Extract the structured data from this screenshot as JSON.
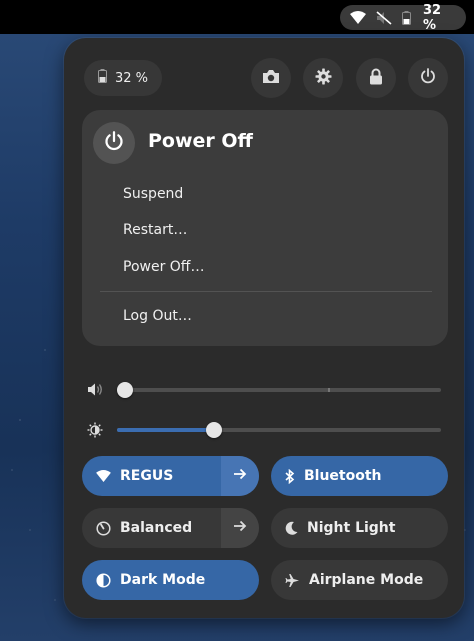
{
  "topbar": {
    "battery_percent": "32 %"
  },
  "quick_settings": {
    "battery_percent": "32 %",
    "power_menu": {
      "title": "Power Off",
      "items": [
        "Suspend",
        "Restart…",
        "Power Off…",
        "Log Out…"
      ]
    },
    "sliders": {
      "volume_level": 0.0,
      "brightness_level": 0.3
    },
    "toggles": [
      {
        "label": "REGUS",
        "icon": "wifi-icon",
        "state": "on",
        "has_arrow": true
      },
      {
        "label": "Bluetooth",
        "icon": "bluetooth-icon",
        "state": "on",
        "has_arrow": false
      },
      {
        "label": "Balanced",
        "icon": "power-profile-icon",
        "state": "off",
        "has_arrow": true
      },
      {
        "label": "Night Light",
        "icon": "moon-icon",
        "state": "off",
        "has_arrow": false
      },
      {
        "label": "Dark Mode",
        "icon": "dark-mode-icon",
        "state": "on",
        "has_arrow": false
      },
      {
        "label": "Airplane Mode",
        "icon": "airplane-icon",
        "state": "off",
        "has_arrow": false
      }
    ]
  },
  "colors": {
    "accent": "#3667a6",
    "panel": "#2b2b2b",
    "menu": "#3c3c3c"
  }
}
